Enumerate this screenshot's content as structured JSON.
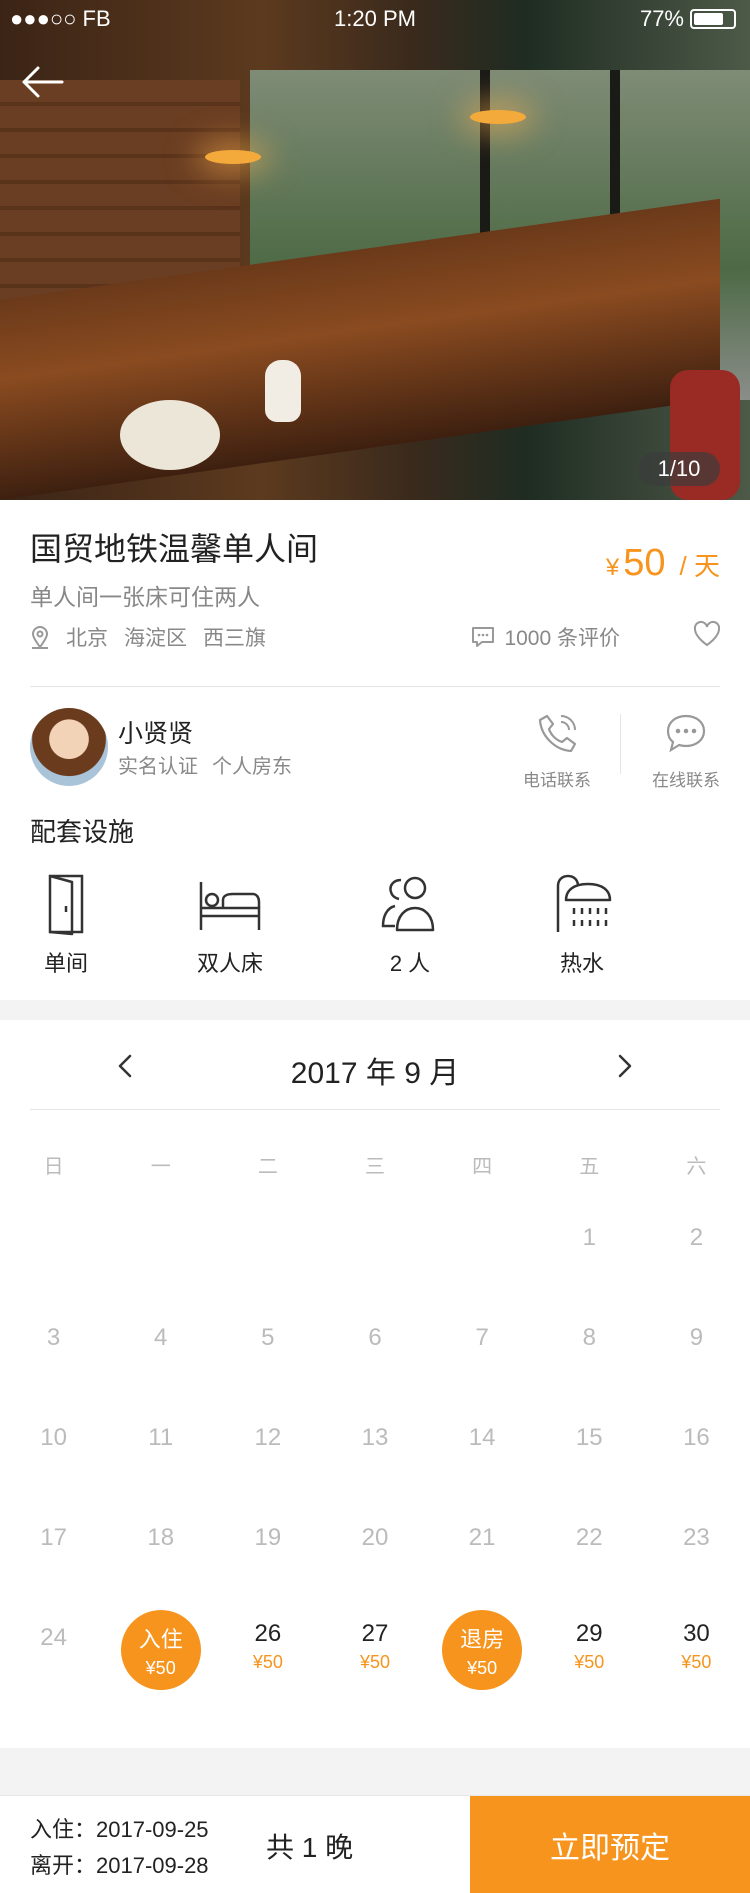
{
  "status_bar": {
    "carrier": "●●●○○ FB",
    "time": "1:20 PM",
    "battery": "77%",
    "battery_level": 0.77
  },
  "gallery": {
    "pager": "1/10"
  },
  "listing": {
    "title": "国贸地铁温馨单人间",
    "subtitle": "单人间一张床可住两人",
    "price_symbol": "¥",
    "price_amount": "50",
    "price_unit": "/ 天",
    "location": [
      "北京",
      "海淀区",
      "西三旗"
    ],
    "reviews": "1000 条评价"
  },
  "host": {
    "name": "小贤贤",
    "tags": [
      "实名认证",
      "个人房东"
    ],
    "phone_label": "电话联系",
    "chat_label": "在线联系"
  },
  "facilities": {
    "title": "配套设施",
    "items": [
      {
        "label": "单间",
        "icon": "door-icon"
      },
      {
        "label": "双人床",
        "icon": "bed-icon"
      },
      {
        "label": "2 人",
        "icon": "people-icon"
      },
      {
        "label": "热水",
        "icon": "shower-icon"
      }
    ]
  },
  "calendar": {
    "month": "2017 年 9 月",
    "weekdays": [
      "日",
      "一",
      "二",
      "三",
      "四",
      "五",
      "六"
    ],
    "days": [
      {
        "n": ""
      },
      {
        "n": ""
      },
      {
        "n": ""
      },
      {
        "n": ""
      },
      {
        "n": ""
      },
      {
        "n": "1"
      },
      {
        "n": "2"
      },
      {
        "n": "3"
      },
      {
        "n": "4"
      },
      {
        "n": "5"
      },
      {
        "n": "6"
      },
      {
        "n": "7"
      },
      {
        "n": "8"
      },
      {
        "n": "9"
      },
      {
        "n": "10"
      },
      {
        "n": "11"
      },
      {
        "n": "12"
      },
      {
        "n": "13"
      },
      {
        "n": "14"
      },
      {
        "n": "15"
      },
      {
        "n": "16"
      },
      {
        "n": "17"
      },
      {
        "n": "18"
      },
      {
        "n": "19"
      },
      {
        "n": "20"
      },
      {
        "n": "21"
      },
      {
        "n": "22"
      },
      {
        "n": "23"
      },
      {
        "n": "24"
      },
      {
        "n": "入住",
        "price": "¥50",
        "state": "checkin"
      },
      {
        "n": "26",
        "price": "¥50",
        "state": "avail"
      },
      {
        "n": "27",
        "price": "¥50",
        "state": "avail"
      },
      {
        "n": "退房",
        "price": "¥50",
        "state": "checkout"
      },
      {
        "n": "29",
        "price": "¥50",
        "state": "avail"
      },
      {
        "n": "30",
        "price": "¥50",
        "state": "avail"
      }
    ]
  },
  "booking": {
    "checkin": "入住：2017-09-25",
    "checkout": "离开：2017-09-28",
    "nights": "共 1 晚",
    "button": "立即预定"
  },
  "colors": {
    "accent": "#f7941d"
  }
}
